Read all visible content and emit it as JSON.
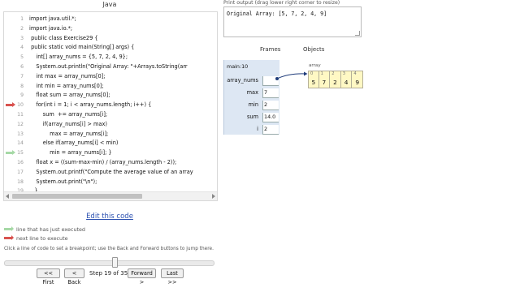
{
  "code_panel": {
    "title": "Java",
    "lines": [
      {
        "num": "1",
        "text": "import java.util.*;",
        "marker": ""
      },
      {
        "num": "2",
        "text": "import java.io.*;",
        "marker": ""
      },
      {
        "num": "3",
        "text": " public class Exercise29 {",
        "marker": ""
      },
      {
        "num": "4",
        "text": " public static void main(String[] args) {",
        "marker": ""
      },
      {
        "num": "5",
        "text": "    int[] array_nums = {5, 7, 2, 4, 9};",
        "marker": ""
      },
      {
        "num": "6",
        "text": "    System.out.println(\"Original Array: \"+Arrays.toString(arr",
        "marker": ""
      },
      {
        "num": "7",
        "text": "    int max = array_nums[0];",
        "marker": ""
      },
      {
        "num": "8",
        "text": "    int min = array_nums[0];",
        "marker": ""
      },
      {
        "num": "9",
        "text": "    float sum = array_nums[0];",
        "marker": ""
      },
      {
        "num": "10",
        "text": "    for(int i = 1; i < array_nums.length; i++) {",
        "marker": "current"
      },
      {
        "num": "11",
        "text": "        sum  += array_nums[i];",
        "marker": ""
      },
      {
        "num": "12",
        "text": "        if(array_nums[i] > max)",
        "marker": ""
      },
      {
        "num": "13",
        "text": "            max = array_nums[i];",
        "marker": ""
      },
      {
        "num": "14",
        "text": "        else if(array_nums[i] < min)",
        "marker": ""
      },
      {
        "num": "15",
        "text": "            min = array_nums[i]; }",
        "marker": "next"
      },
      {
        "num": "16",
        "text": "    float x = ((sum-max-min) / (array_nums.length - 2));",
        "marker": ""
      },
      {
        "num": "17",
        "text": "    System.out.printf(\"Compute the average value of an array",
        "marker": ""
      },
      {
        "num": "18",
        "text": "    System.out.print(\"\\n\");",
        "marker": ""
      },
      {
        "num": "19",
        "text": "   }",
        "marker": ""
      },
      {
        "num": "20",
        "text": " }",
        "marker": ""
      }
    ]
  },
  "edit_link": "Edit this code",
  "legend": {
    "executed": "line that has just executed",
    "next": "next line to execute"
  },
  "hint": "Click a line of code to set a breakpoint; use the Back and Forward buttons to jump there.",
  "slider": {
    "current_step": 19,
    "total_steps": 35
  },
  "navigation": {
    "first": "<< First",
    "back": "< Back",
    "step_text": "Step 19 of 35",
    "forward": "Forward >",
    "last": "Last >>"
  },
  "output": {
    "label": "Print output (drag lower right corner to resize)",
    "text": "Original Array: [5, 7, 2, 4, 9]"
  },
  "visualization": {
    "frames_header": "Frames",
    "objects_header": "Objects",
    "frame": {
      "name": "main:10",
      "variables": [
        {
          "name": "array_nums",
          "value": ""
        },
        {
          "name": "max",
          "value": "7"
        },
        {
          "name": "min",
          "value": "2"
        },
        {
          "name": "sum",
          "value": "14.0"
        },
        {
          "name": "i",
          "value": "2"
        }
      ]
    },
    "array": {
      "label": "array",
      "indices": [
        "0",
        "1",
        "2",
        "3",
        "4"
      ],
      "values": [
        "5",
        "7",
        "2",
        "4",
        "9"
      ]
    }
  },
  "colors": {
    "current_line_arrow": "#d9534f",
    "next_line_arrow": "#a6d9a6",
    "frame_background": "#dde7f3",
    "array_cell_background": "#fff8c4",
    "link": "#2a4fb0"
  }
}
